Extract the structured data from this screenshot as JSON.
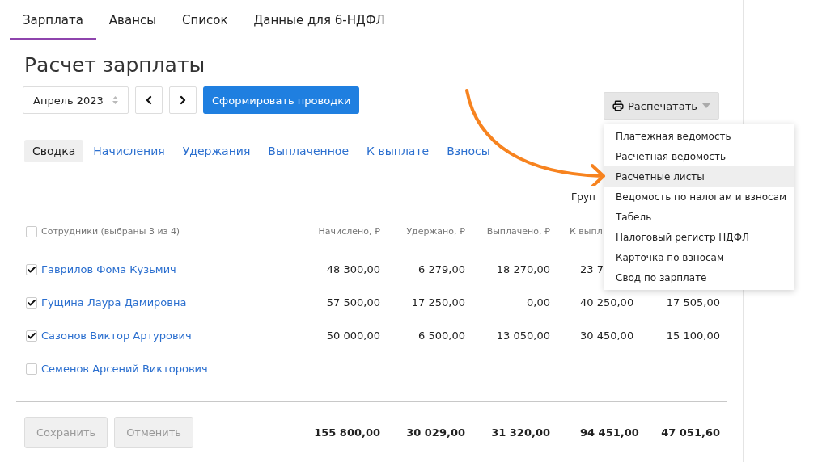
{
  "top_tabs": [
    {
      "label": "Зарплата",
      "selected": true
    },
    {
      "label": "Авансы",
      "selected": false
    },
    {
      "label": "Список",
      "selected": false
    },
    {
      "label": "Данные для 6-НДФЛ",
      "selected": false
    }
  ],
  "title": "Расчет зарплаты",
  "period": {
    "value": "Апрель 2023"
  },
  "post_button": "Сформировать проводки",
  "print": {
    "label": "Распечатать",
    "expanded": true,
    "menu": [
      {
        "label": "Платежная ведомость",
        "selected": false
      },
      {
        "label": "Расчетная ведомость",
        "selected": false
      },
      {
        "label": "Расчетные листы",
        "selected": true
      },
      {
        "label": "Ведомость по налогам и взносам",
        "selected": false
      },
      {
        "label": "Табель",
        "selected": false
      },
      {
        "label": "Налоговый регистр НДФЛ",
        "selected": false
      },
      {
        "label": "Карточка по взносам",
        "selected": false
      },
      {
        "label": "Свод по зарплате",
        "selected": false
      }
    ]
  },
  "view_tabs": [
    {
      "label": "Сводка",
      "selected": true
    },
    {
      "label": "Начисления",
      "selected": false
    },
    {
      "label": "Удержания",
      "selected": false
    },
    {
      "label": "Выплаченное",
      "selected": false
    },
    {
      "label": "К выплате",
      "selected": false
    },
    {
      "label": "Взносы",
      "selected": false
    }
  ],
  "grouping_label": "Груп",
  "table": {
    "select_all_checked": false,
    "columns": [
      "Сотрудники (выбраны 3 из 4)",
      "Начислено, ₽",
      "Удержано, ₽",
      "Выплачено, ₽",
      "К выпл"
    ],
    "rows": [
      {
        "name": "Гаврилов Фома Кузьмич",
        "checked": true,
        "values": [
          "48 300,00",
          "6 279,00",
          "18 270,00",
          "23 7"
        ]
      },
      {
        "name": "Гущина Лаура Дамировна",
        "checked": true,
        "values": [
          "57 500,00",
          "17 250,00",
          "0,00",
          "40 250,00",
          "17 505,00"
        ]
      },
      {
        "name": "Сазонов Виктор Артурович",
        "checked": true,
        "values": [
          "50 000,00",
          "6 500,00",
          "13 050,00",
          "30 450,00",
          "15 100,00"
        ]
      },
      {
        "name": "Семенов Арсений Викторович",
        "checked": false
      }
    ],
    "totals": [
      "155 800,00",
      "30 029,00",
      "31 320,00",
      "94 451,00",
      "47 051,60"
    ]
  },
  "buttons": [
    {
      "label": "Сохранить",
      "disabled": true
    },
    {
      "label": "Отменить",
      "disabled": true
    }
  ]
}
